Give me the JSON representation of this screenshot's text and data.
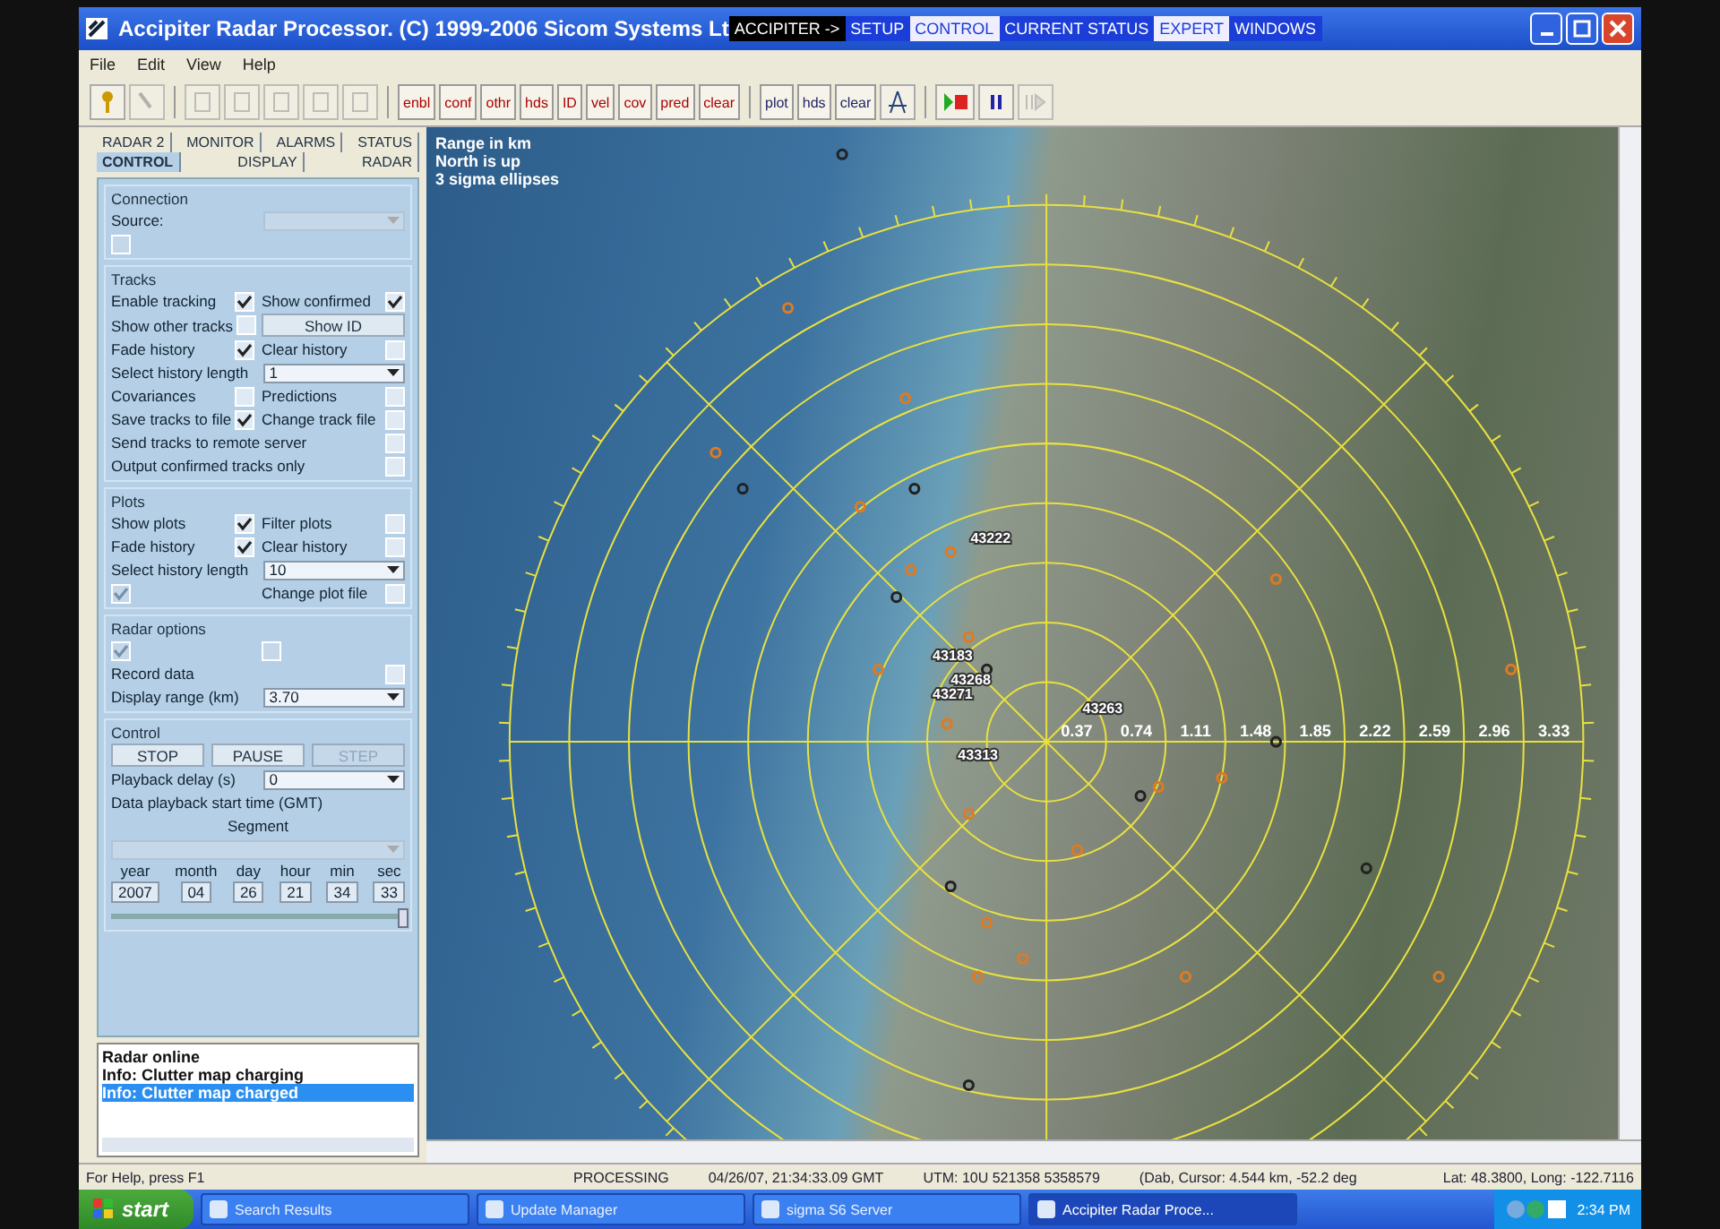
{
  "window": {
    "title": "Accipiter Radar Processor.  (C) 1999-2006 Sicom Systems Lt"
  },
  "mode_bar": [
    {
      "label": "ACCIPITER ->",
      "kind": "prefix",
      "selected": false
    },
    {
      "label": "SETUP",
      "kind": "mode",
      "selected": false
    },
    {
      "label": "CONTROL",
      "kind": "mode",
      "selected": true
    },
    {
      "label": "CURRENT STATUS",
      "kind": "mode",
      "selected": false
    },
    {
      "label": "EXPERT",
      "kind": "mode",
      "selected": true
    },
    {
      "label": "WINDOWS",
      "kind": "mode",
      "selected": false
    }
  ],
  "menu": [
    "File",
    "Edit",
    "View",
    "Help"
  ],
  "toolbar": {
    "track_buttons": [
      "enbl",
      "conf",
      "othr",
      "hds",
      "ID",
      "vel",
      "cov",
      "pred",
      "clear"
    ],
    "plot_buttons": [
      "plot",
      "hds",
      "clear"
    ]
  },
  "tabs": {
    "back_row": [
      {
        "label": "RADAR 2",
        "selected": false
      },
      {
        "label": "MONITOR",
        "selected": false
      },
      {
        "label": "ALARMS",
        "selected": false
      },
      {
        "label": "STATUS",
        "selected": false
      }
    ],
    "front_row": [
      {
        "label": "CONTROL",
        "selected": true
      },
      {
        "label": "DISPLAY",
        "selected": false
      },
      {
        "label": "RADAR",
        "selected": false
      }
    ]
  },
  "sections": [
    {
      "title": "Connection",
      "rows": [
        {
          "items": [
            {
              "kind": "select",
              "label": "Source:",
              "disabled": true
            }
          ]
        },
        {
          "items": [
            {
              "kind": "check",
              "checked": false,
              "disabled": true
            }
          ]
        }
      ]
    },
    {
      "title": "Tracks",
      "rows": [
        {
          "items": [
            {
              "kind": "check",
              "label": "Enable tracking",
              "checked": true,
              "disabled": false
            },
            {
              "kind": "check",
              "label": "Show confirmed",
              "checked": true,
              "disabled": false
            }
          ]
        },
        {
          "items": [
            {
              "kind": "check",
              "label": "Show other tracks",
              "checked": false,
              "disabled": false
            },
            {
              "kind": "button",
              "label": "Show ID",
              "disabled": false
            }
          ]
        },
        {
          "items": [
            {
              "kind": "check",
              "label": "Fade history",
              "checked": true,
              "disabled": false
            },
            {
              "kind": "check",
              "label": "Clear history",
              "checked": false,
              "disabled": false
            }
          ]
        },
        {
          "items": [
            {
              "kind": "select",
              "label": "Select history length",
              "value": "1",
              "disabled": false
            }
          ]
        },
        {
          "items": [
            {
              "kind": "check",
              "label": "Covariances",
              "checked": false,
              "disabled": false
            },
            {
              "kind": "check",
              "label": "Predictions",
              "checked": false,
              "disabled": false
            }
          ]
        },
        {
          "items": [
            {
              "kind": "check",
              "label": "Save tracks to file",
              "checked": true,
              "disabled": false
            },
            {
              "kind": "check",
              "label": "Change track file",
              "checked": false,
              "disabled": false
            }
          ]
        },
        {
          "items": [
            {
              "kind": "check",
              "label": "Send tracks to remote server",
              "checked": false,
              "disabled": false
            }
          ]
        },
        {
          "items": [
            {
              "kind": "check",
              "label": "Output confirmed tracks only",
              "checked": false,
              "disabled": false
            }
          ]
        }
      ]
    },
    {
      "title": "Plots",
      "rows": [
        {
          "items": [
            {
              "kind": "check",
              "label": "Show plots",
              "checked": true,
              "disabled": false
            },
            {
              "kind": "check",
              "label": "Filter plots",
              "checked": false,
              "disabled": false
            }
          ]
        },
        {
          "items": [
            {
              "kind": "check",
              "label": "Fade history",
              "checked": true,
              "disabled": false
            },
            {
              "kind": "check",
              "label": "Clear history",
              "checked": false,
              "disabled": false
            }
          ]
        },
        {
          "items": [
            {
              "kind": "select",
              "label": "Select history length",
              "value": "10",
              "disabled": false
            }
          ]
        },
        {
          "items": [
            {
              "kind": "check",
              "checked": true,
              "disabled": true
            },
            {
              "kind": "check",
              "label": "Change plot file",
              "checked": false,
              "disabled": false
            }
          ]
        }
      ]
    },
    {
      "title": "Radar options",
      "rows": [
        {
          "items": [
            {
              "kind": "check",
              "checked": true,
              "disabled": true
            },
            {
              "kind": "check",
              "checked": false,
              "disabled": true
            }
          ]
        },
        {
          "items": [
            {
              "kind": "check",
              "label": "Record data",
              "checked": false,
              "disabled": false
            }
          ]
        },
        {
          "items": [
            {
              "kind": "select",
              "label": "Display range (km)",
              "value": "3.70",
              "disabled": false
            }
          ]
        }
      ]
    },
    {
      "title": "Control",
      "rows": [
        {
          "items": [
            {
              "kind": "button",
              "label": "STOP",
              "disabled": false
            },
            {
              "kind": "button",
              "label": "PAUSE",
              "disabled": false
            },
            {
              "kind": "button",
              "label": "STEP",
              "disabled": true
            }
          ]
        },
        {
          "items": [
            {
              "kind": "select",
              "label": "Playback delay (s)",
              "value": "0",
              "disabled": false
            }
          ]
        },
        {
          "items": [
            {
              "kind": "text",
              "label": "Data playback start time (GMT)"
            }
          ]
        },
        {
          "items": [
            {
              "kind": "heading",
              "label": "Segment"
            }
          ]
        },
        {
          "items": [
            {
              "kind": "select",
              "disabled": true
            }
          ]
        },
        {
          "items": [
            {
              "kind": "date",
              "fields": [
                {
                  "label": "year",
                  "value": "2007"
                },
                {
                  "label": "month",
                  "value": "04"
                },
                {
                  "label": "day",
                  "value": "26"
                },
                {
                  "label": "hour",
                  "value": "21"
                },
                {
                  "label": "min",
                  "value": "34"
                },
                {
                  "label": "sec",
                  "value": "33"
                }
              ]
            }
          ]
        },
        {
          "items": [
            {
              "kind": "slider",
              "level": 1
            }
          ]
        }
      ]
    }
  ],
  "log": [
    {
      "text": "Radar online",
      "selected": false
    },
    {
      "text": "Info: Clutter map charging",
      "selected": false
    },
    {
      "text": "Info: Clutter map charged",
      "selected": true
    }
  ],
  "map": {
    "legend": [
      "Range in km",
      "North is up",
      "3 sigma ellipses"
    ],
    "range_labels": [
      "0.37",
      "0.74",
      "1.11",
      "1.48",
      "1.85",
      "2.22",
      "2.59",
      "2.96",
      "3.33"
    ],
    "tracks": [
      "43222",
      "43183",
      "43268",
      "43271",
      "43313",
      "43263"
    ]
  },
  "status_bar": {
    "help": "For Help, press F1",
    "state": "PROCESSING",
    "time": "04/26/07,  21:34:33.09 GMT",
    "utm": "UTM: 10U  521358  5358579",
    "cursor": "(Dab, Cursor: 4.544 km, -52.2 deg",
    "latlong": "Lat: 48.3800, Long: -122.7116"
  },
  "taskbar": {
    "start": "start",
    "items": [
      {
        "label": "Search Results",
        "selected": false
      },
      {
        "label": "Update Manager",
        "selected": false
      },
      {
        "label": "sigma S6 Server",
        "selected": false
      },
      {
        "label": "Accipiter Radar Proce...",
        "selected": true
      }
    ],
    "clock": "2:34 PM"
  }
}
